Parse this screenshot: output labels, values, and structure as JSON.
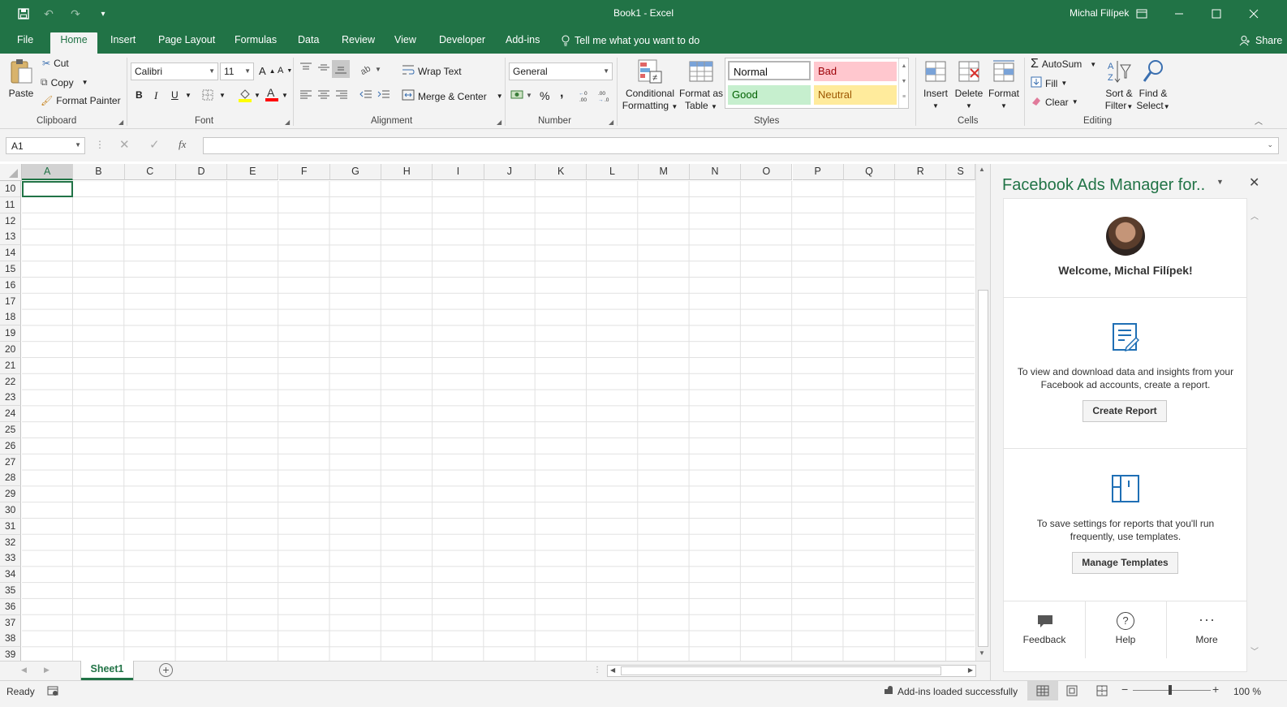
{
  "window": {
    "title": "Book1  -  Excel",
    "user": "Michal Filípek"
  },
  "tabs": [
    "File",
    "Home",
    "Insert",
    "Page Layout",
    "Formulas",
    "Data",
    "Review",
    "View",
    "Developer",
    "Add-ins"
  ],
  "tell_me": "Tell me what you want to do",
  "share": "Share",
  "clipboard": {
    "paste": "Paste",
    "cut": "Cut",
    "copy": "Copy",
    "format_painter": "Format Painter",
    "label": "Clipboard"
  },
  "font": {
    "name": "Calibri",
    "size": "11",
    "bold": "B",
    "italic": "I",
    "underline": "U",
    "label": "Font"
  },
  "alignment": {
    "wrap_text": "Wrap Text",
    "merge_center": "Merge & Center",
    "label": "Alignment"
  },
  "number": {
    "format": "General",
    "percent": "%",
    "comma": ",",
    "label": "Number"
  },
  "styles": {
    "conditional": [
      "Conditional",
      "Formatting"
    ],
    "format_table": [
      "Format as",
      "Table"
    ],
    "normal": "Normal",
    "bad": "Bad",
    "good": "Good",
    "neutral": "Neutral",
    "label": "Styles"
  },
  "cells_group": {
    "insert": "Insert",
    "delete": "Delete",
    "format": "Format",
    "label": "Cells"
  },
  "editing": {
    "autosum": "AutoSum",
    "fill": "Fill",
    "clear": "Clear",
    "sort": [
      "Sort &",
      "Filter"
    ],
    "find": [
      "Find &",
      "Select"
    ],
    "label": "Editing"
  },
  "formula_bar": {
    "name_box": "A1",
    "fx": "fx"
  },
  "columns": [
    "A",
    "B",
    "C",
    "D",
    "E",
    "F",
    "G",
    "H",
    "I",
    "J",
    "K",
    "L",
    "M",
    "N",
    "O",
    "P",
    "Q",
    "R",
    "S"
  ],
  "rows": [
    "10",
    "11",
    "12",
    "13",
    "14",
    "15",
    "16",
    "17",
    "18",
    "19",
    "20",
    "21",
    "22",
    "23",
    "24",
    "25",
    "26",
    "27",
    "28",
    "29",
    "30",
    "31",
    "32",
    "33",
    "34",
    "35",
    "36",
    "37",
    "38",
    "39"
  ],
  "sheet_tab": "Sheet1",
  "status": {
    "ready": "Ready",
    "addins": "Add-ins loaded successfully",
    "zoom": "100 %"
  },
  "pane": {
    "title": "Facebook Ads Manager for..",
    "welcome": "Welcome, Michal Filípek!",
    "report_text_1": "To view and download data and insights from your",
    "report_text_2": "Facebook ad accounts, create a report.",
    "create_report": "Create Report",
    "template_text_1": "To save settings for reports that you'll run",
    "template_text_2": "frequently, use templates.",
    "manage_templates": "Manage Templates",
    "feedback": "Feedback",
    "help": "Help",
    "more": "More"
  },
  "colors": {
    "accent": "#217346",
    "bad_bg": "#ffc7ce",
    "bad_fg": "#9c0006",
    "good_bg": "#c6efce",
    "good_fg": "#006100",
    "neutral_bg": "#ffeb9c",
    "neutral_fg": "#9c5700",
    "facebook_blue": "#1f6fb5"
  }
}
